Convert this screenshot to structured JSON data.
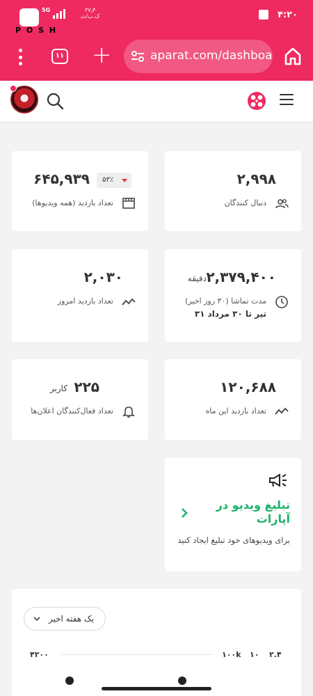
{
  "status_bar": {
    "time": "۴:۲۰",
    "network": "5G",
    "speed_value": "۳۷٫۴",
    "speed_unit": "ک.ب/ث",
    "logo_text": "P O S H"
  },
  "browser": {
    "tabs_count": "۱۱",
    "url": "aparat.com/dashboard"
  },
  "cards": {
    "followers": {
      "value": "۲,۹۹۸",
      "label": "دنبال کنندگان"
    },
    "total_views": {
      "value": "۶۴۵,۹۳۹",
      "label": "تعداد بازدید (همه ویدیوها)",
      "badge": "۵۳٪"
    },
    "watch_time": {
      "value": "۲,۳۷۹,۴۰۰",
      "unit": "دقیقه",
      "label": "مدت تماشا (۳۰ روز اخیر)",
      "range": "۳۱ تیر تا ۳۰ مرداد"
    },
    "today_views": {
      "value": "۲,۰۳۰",
      "label": "تعداد بازدید امروز"
    },
    "month_views": {
      "value": "۱۲۰,۶۸۸",
      "label": "تعداد بازدید این ماه"
    },
    "active_ads": {
      "value": "۲۲۵",
      "unit": "کاربر",
      "label": "تعداد فعال‌کنندگان اعلان‌ها"
    }
  },
  "promo": {
    "title": "تبلیغ ویدیو در آپارات",
    "description": "برای ویدیوهای خود تبلیغ ایجاد کنید"
  },
  "chart": {
    "period": "یک هفته اخیر",
    "legend_left": "۴۲۰۰",
    "legend_a": "۱۰۰k",
    "legend_b": "۱۰",
    "legend_c": "۲.۴"
  },
  "colors": {
    "brand": "#ee2a61",
    "promo_green": "#1bb26a"
  }
}
